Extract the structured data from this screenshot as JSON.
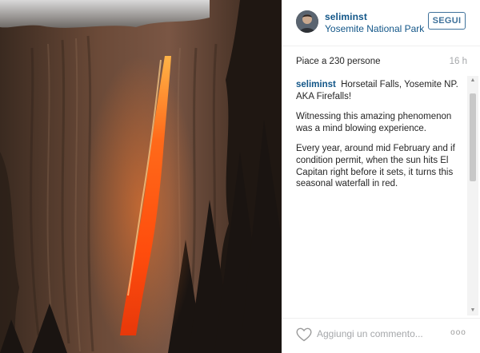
{
  "post": {
    "username": "seliminst",
    "location": "Yosemite National Park",
    "follow_label": "SEGUI",
    "likes_text": "Piace a 230 persone",
    "time_ago": "16 h",
    "caption": {
      "user": "seliminst",
      "first_line": "Horsetail Falls, Yosemite NP. AKA Firefalls!",
      "paragraph_2": "Witnessing this amazing phenomenon was a mind blowing experience.",
      "paragraph_3": "Every year, around mid February and if condition permit, when the sun hits El Capitan right before it sets, it turns this seasonal waterfall in red."
    }
  },
  "footer": {
    "comment_placeholder": "Aggiungi un commento...",
    "more_label": "ooo"
  },
  "icons": {
    "like": "heart-outline-icon",
    "more": "more-options-icon",
    "scroll_up": "triangle-up-icon",
    "scroll_down": "triangle-down-icon"
  },
  "colors": {
    "link_blue": "#125688",
    "button_blue": "#3f729b",
    "muted_gray": "#a5a7aa",
    "fire_orange": "#ff5a1a"
  }
}
